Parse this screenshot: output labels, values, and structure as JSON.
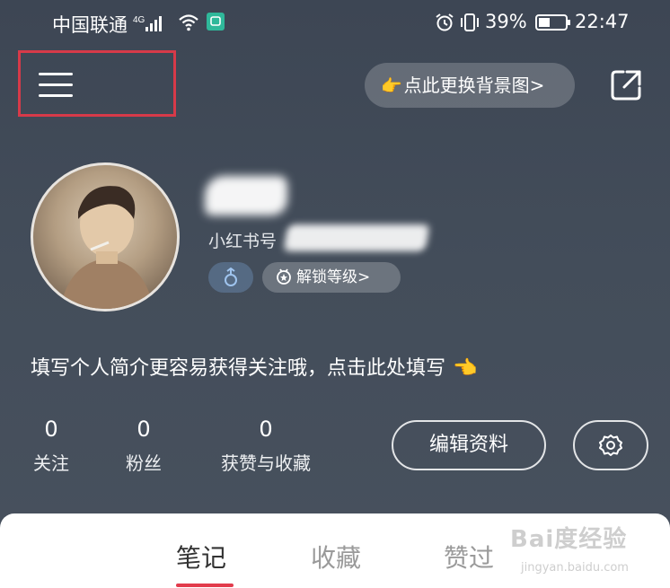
{
  "status_bar": {
    "carrier": "中国联通",
    "network": "4G",
    "battery": "39%",
    "time": "22:47"
  },
  "header": {
    "menu_icon": "hamburger-menu-icon",
    "change_background_label": "点此更换背景图>",
    "share_icon": "share-external-icon"
  },
  "profile": {
    "id_label": "小红书号",
    "gender_icon": "male-icon",
    "unlock_level_label": "解锁等级>",
    "bio_prompt": "填写个人简介更容易获得关注哦，点击此处填写"
  },
  "stats": [
    {
      "value": "0",
      "label": "关注"
    },
    {
      "value": "0",
      "label": "粉丝"
    },
    {
      "value": "0",
      "label": "获赞与收藏"
    }
  ],
  "actions": {
    "edit_profile": "编辑资料",
    "settings_icon": "gear-icon"
  },
  "tabs": [
    {
      "label": "笔记",
      "active": true
    },
    {
      "label": "收藏",
      "active": false
    },
    {
      "label": "赞过",
      "active": false
    }
  ],
  "watermark": {
    "brand": "Bai度经验",
    "url": "jingyan.baidu.com"
  },
  "colors": {
    "background": "#434d5a",
    "accent": "#e23b4c",
    "highlight_box": "#d73a49",
    "hand_emoji": "#f6b43a"
  }
}
